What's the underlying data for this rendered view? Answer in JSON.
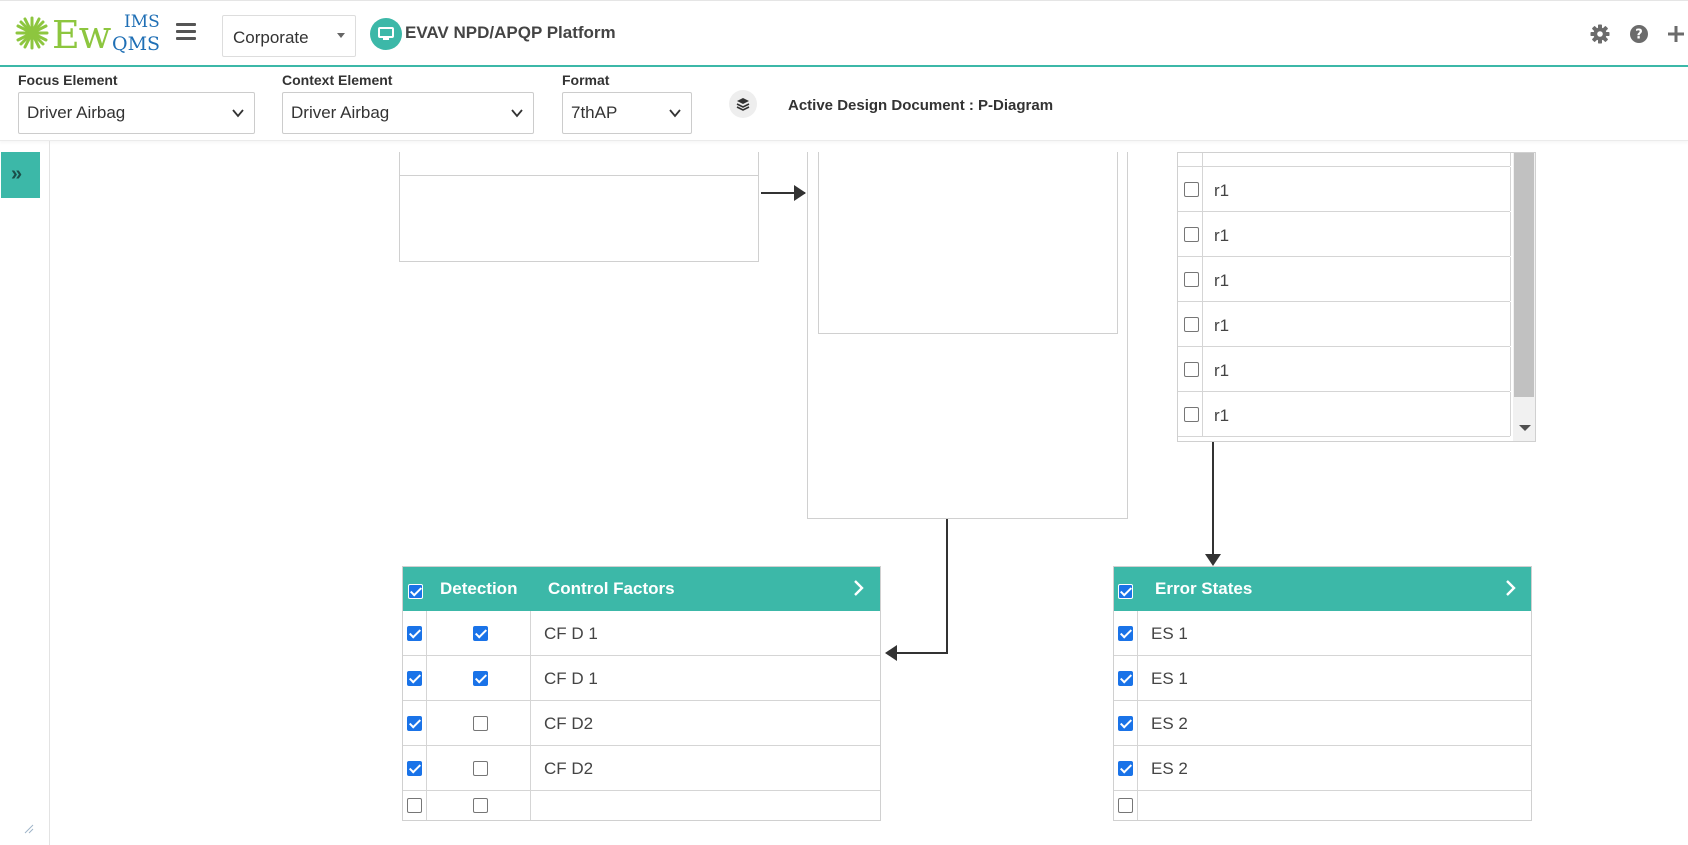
{
  "header": {
    "logo": {
      "ew": "Ew",
      "ims": "IMS",
      "qms": "QMS"
    },
    "org_select": "Corporate",
    "platform_title": "EVAV NPD/APQP Platform",
    "icons": [
      "gear-icon",
      "help-icon",
      "plus-icon"
    ]
  },
  "toolbar": {
    "focus_label": "Focus Element",
    "focus_value": "Driver Airbag",
    "context_label": "Context Element",
    "context_value": "Driver Airbag",
    "format_label": "Format",
    "format_value": "7thAP",
    "active_doc": "Active Design Document : P-Diagram"
  },
  "r_list": {
    "items": [
      {
        "label": "r1",
        "checked": false
      },
      {
        "label": "r1",
        "checked": false
      },
      {
        "label": "r1",
        "checked": false
      },
      {
        "label": "r1",
        "checked": false
      },
      {
        "label": "r1",
        "checked": false
      },
      {
        "label": "r1",
        "checked": false
      }
    ]
  },
  "control_factors": {
    "header": {
      "detection": "Detection",
      "title": "Control Factors",
      "all_checked": true
    },
    "rows": [
      {
        "selected": true,
        "detection": true,
        "label": "CF D 1"
      },
      {
        "selected": true,
        "detection": true,
        "label": "CF D 1"
      },
      {
        "selected": true,
        "detection": false,
        "label": "CF D2"
      },
      {
        "selected": true,
        "detection": false,
        "label": "CF D2"
      },
      {
        "selected": false,
        "detection": false,
        "label": ""
      }
    ]
  },
  "error_states": {
    "header": {
      "title": "Error States",
      "all_checked": true
    },
    "rows": [
      {
        "selected": true,
        "label": "ES 1"
      },
      {
        "selected": true,
        "label": "ES 1"
      },
      {
        "selected": true,
        "label": "ES 2"
      },
      {
        "selected": true,
        "label": "ES 2"
      },
      {
        "selected": false,
        "label": ""
      }
    ]
  },
  "colors": {
    "accent": "#3cb8a8",
    "checkbox": "#1a73e8"
  }
}
